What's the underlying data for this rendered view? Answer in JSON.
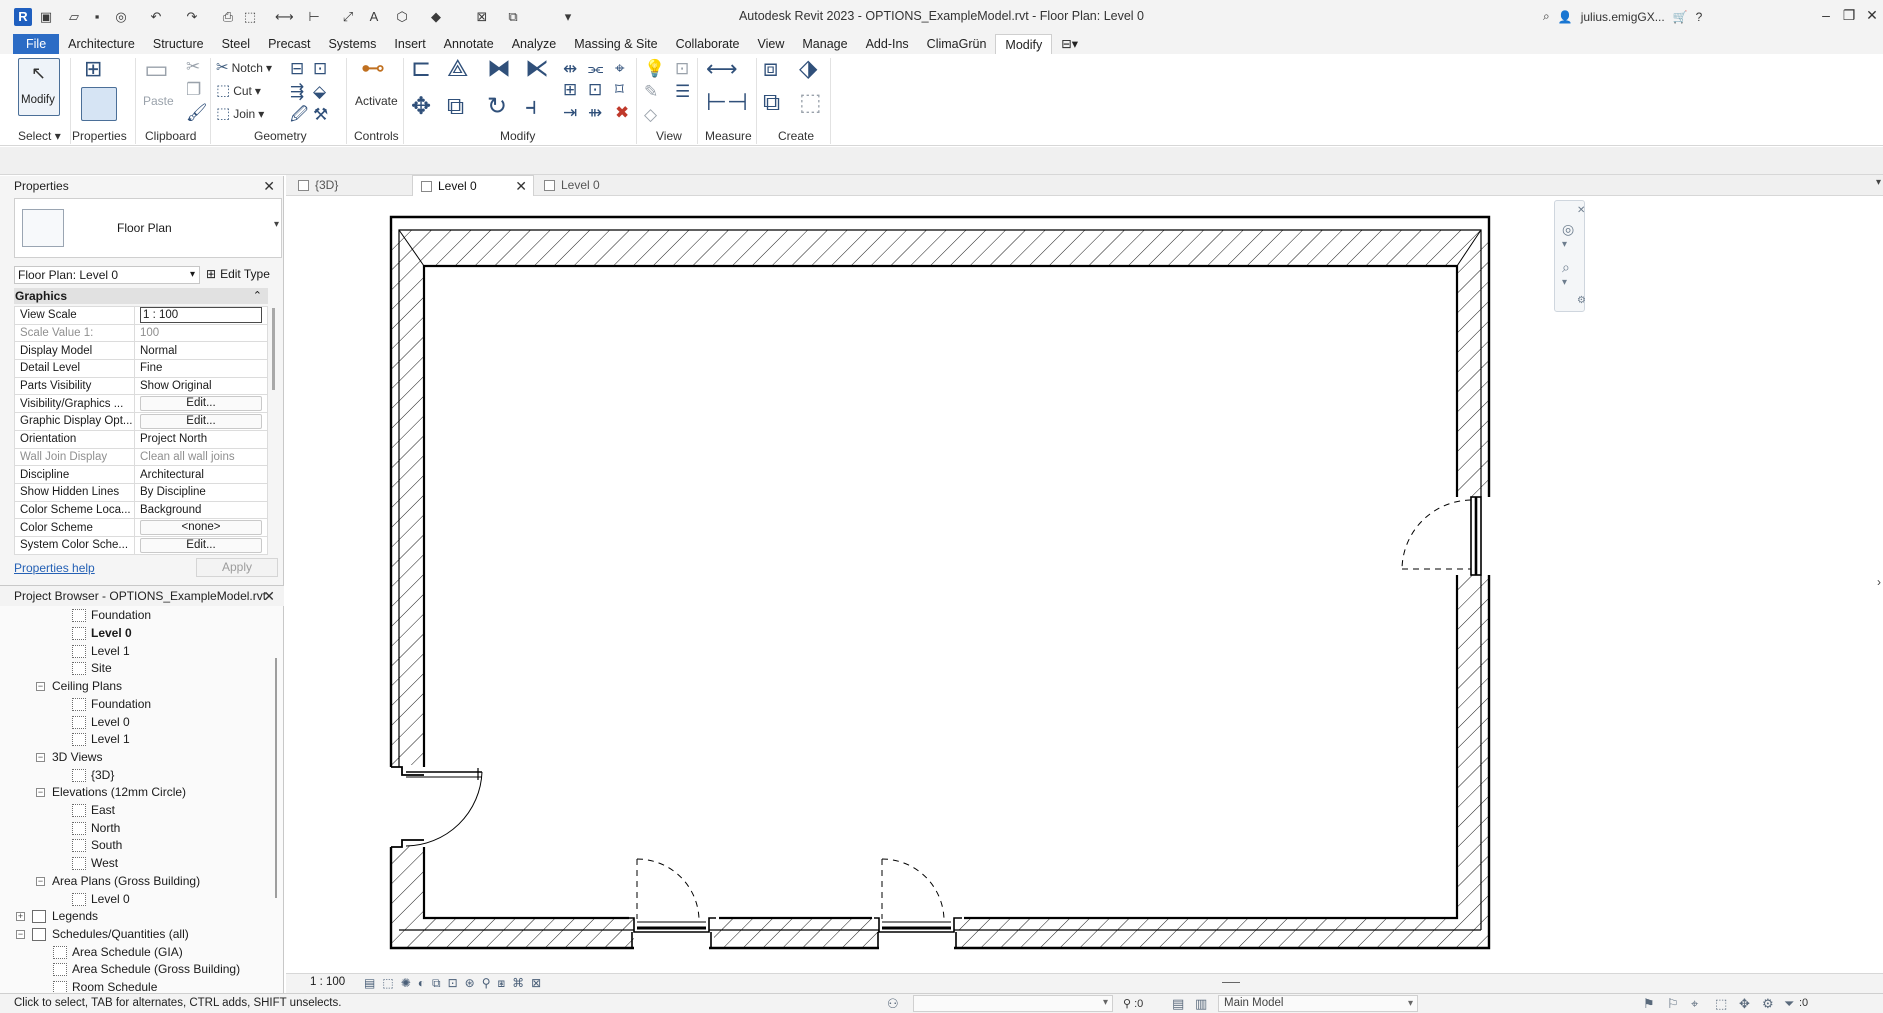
{
  "app": {
    "logo_letter": "R",
    "window_title": "Autodesk Revit 2023 - OPTIONS_ExampleModel.rvt - Floor Plan: Level 0",
    "user_name": "julius.emigGX...",
    "help_label": "?"
  },
  "ribbon_tabs": [
    "File",
    "Architecture",
    "Structure",
    "Steel",
    "Precast",
    "Systems",
    "Insert",
    "Annotate",
    "Analyze",
    "Massing & Site",
    "Collaborate",
    "View",
    "Manage",
    "Add-Ins",
    "ClimaGrün",
    "Modify"
  ],
  "ribbon_active_tab": "Modify",
  "ribbon": {
    "modify_label": "Modify",
    "properties_label": "Properties",
    "paste_label": "Paste",
    "notch_label": "Notch",
    "cut_label": "Cut",
    "join_label": "Join",
    "activate_label": "Activate",
    "panels": {
      "select": "Select",
      "properties": "Properties",
      "clipboard": "Clipboard",
      "geometry": "Geometry",
      "controls": "Controls",
      "modify": "Modify",
      "view": "View",
      "measure": "Measure",
      "create": "Create"
    }
  },
  "properties": {
    "title": "Properties",
    "type_name": "Floor Plan",
    "instance_selector": "Floor Plan: Level 0",
    "edit_type_label": "Edit Type",
    "section": "Graphics",
    "rows": [
      {
        "name": "View Scale",
        "value": "1 : 100"
      },
      {
        "name": "Scale Value    1:",
        "value": "100"
      },
      {
        "name": "Display Model",
        "value": "Normal"
      },
      {
        "name": "Detail Level",
        "value": "Fine"
      },
      {
        "name": "Parts Visibility",
        "value": "Show Original"
      },
      {
        "name": "Visibility/Graphics ...",
        "value": "Edit..."
      },
      {
        "name": "Graphic Display Opt...",
        "value": "Edit..."
      },
      {
        "name": "Orientation",
        "value": "Project North"
      },
      {
        "name": "Wall Join Display",
        "value": "Clean all wall joins"
      },
      {
        "name": "Discipline",
        "value": "Architectural"
      },
      {
        "name": "Show Hidden Lines",
        "value": "By Discipline"
      },
      {
        "name": "Color Scheme Loca...",
        "value": "Background"
      },
      {
        "name": "Color Scheme",
        "value": "<none>"
      },
      {
        "name": "System Color Sche...",
        "value": "Edit..."
      }
    ],
    "help_link": "Properties help",
    "apply_label": "Apply"
  },
  "browser": {
    "title": "Project Browser - OPTIONS_ExampleModel.rvt",
    "items": [
      "Foundation",
      "Level 0",
      "Level 1",
      "Site",
      "Ceiling Plans",
      "Foundation",
      "Level 0",
      "Level 1",
      "3D Views",
      "{3D}",
      "Elevations (12mm Circle)",
      "East",
      "North",
      "South",
      "West",
      "Area Plans (Gross Building)",
      "Level 0",
      "Legends",
      "Schedules/Quantities (all)",
      "Area Schedule (GIA)",
      "Area Schedule (Gross Building)",
      "Room Schedule"
    ],
    "selected": "Level 0"
  },
  "view_tabs": [
    {
      "label": "{3D}"
    },
    {
      "label": "Level 0"
    },
    {
      "label": "Level 0"
    }
  ],
  "view_control": {
    "scale": "1 : 100"
  },
  "status": {
    "message": "Click to select, TAB for alternates, CTRL adds, SHIFT unselects.",
    "editable_count": ":0",
    "model": "Main Model",
    "selection_count": ":0"
  },
  "icons": {
    "modify_cursor": "cursor-arrow-icon",
    "close": "close-icon"
  },
  "colors": {
    "file_tab": "#2c6cc5",
    "link": "#2561b5",
    "plan_lines": "#000000"
  }
}
